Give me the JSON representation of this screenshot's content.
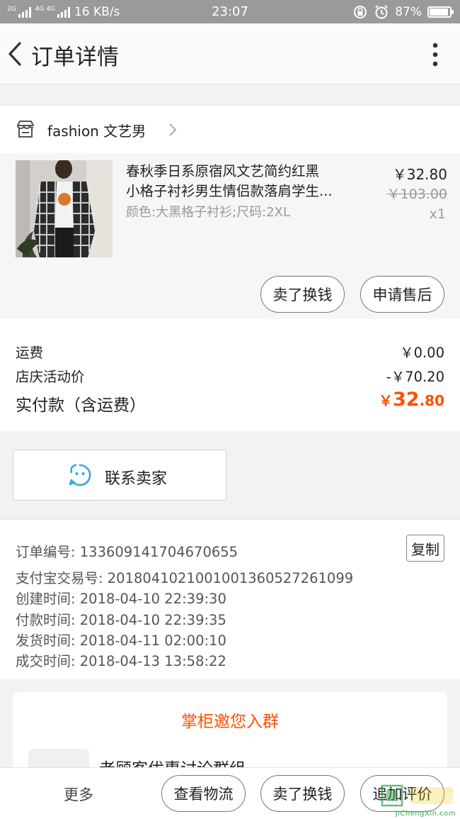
{
  "status_bar": {
    "signal1_label": "2G",
    "signal2_label": "4G 4G",
    "speed": "16 KB/s",
    "time": "23:07",
    "battery": "87%"
  },
  "navbar": {
    "title": "订单详情"
  },
  "shop": {
    "name": "fashion  文艺男"
  },
  "item": {
    "title_line1": "春秋季日系原宿风文艺简约红黑",
    "title_line2": "小格子衬衫男生情侣款落肩学生...",
    "spec": "颜色:大黑格子衬衫;尺码:2XL",
    "price": "￥32.80",
    "original_price": "￥103.00",
    "quantity": "x1",
    "buttons": [
      "卖了换钱",
      "申请售后"
    ]
  },
  "fees": {
    "shipping_label": "运费",
    "shipping_value": "￥0.00",
    "promo_label": "店庆活动价",
    "promo_value": "-￥70.20",
    "total_label": "实付款（含运费）",
    "total_currency": "￥",
    "total_int": "32",
    "total_dec": ".80"
  },
  "contact": {
    "label": "联系卖家"
  },
  "order_info": {
    "order_no": "订单编号: 133609141704670655",
    "copy_label": "复制",
    "alipay_no": "支付宝交易号: 2018041021001001360527261099",
    "created": "创建时间: 2018-04-10 22:39:30",
    "paid": "付款时间: 2018-04-10 22:39:35",
    "shipped": "发货时间: 2018-04-11 02:00:10",
    "completed": "成交时间: 2018-04-13 13:58:22"
  },
  "group": {
    "title": "掌柜邀您入群",
    "name": "老顾客优惠讨论群组"
  },
  "bottom_bar": {
    "more": "更多",
    "logistics": "查看物流",
    "sell": "卖了换钱",
    "review": "追加评价"
  },
  "watermark": {
    "text": "JiChengXin.com"
  },
  "colors": {
    "accent": "#ff5000",
    "status_bar": "#9a9a9a",
    "contact_icon": "#2fa9e6"
  },
  "icons": [
    "back-icon",
    "more-icon",
    "shop-icon",
    "chevron-right-icon",
    "contact-seller-icon"
  ]
}
